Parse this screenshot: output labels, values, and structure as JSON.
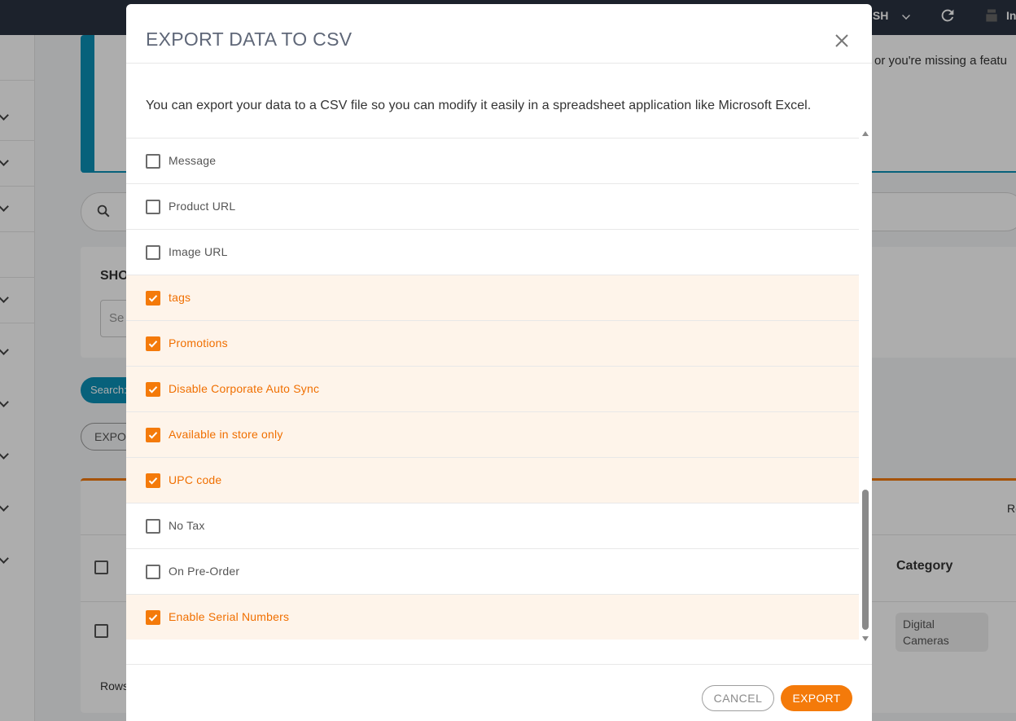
{
  "background": {
    "topbar": {
      "language_label": "ISH",
      "user_label": "In"
    },
    "banner_text": "or you're missing a featu",
    "filter": {
      "label": "SHO",
      "select_placeholder": "Se"
    },
    "search_chip": "Search:",
    "export_button": "EXPOR",
    "table": {
      "right_header": "Re",
      "category_header": "Category",
      "category_value": "Digital Cameras",
      "rows_label": "Rows"
    }
  },
  "modal": {
    "title": "EXPORT DATA TO CSV",
    "description": "You can export your data to a CSV file so you can modify it easily in a spreadsheet application like Microsoft Excel.",
    "fields": [
      {
        "label": "Message",
        "checked": false
      },
      {
        "label": "Product URL",
        "checked": false
      },
      {
        "label": "Image URL",
        "checked": false
      },
      {
        "label": "tags",
        "checked": true
      },
      {
        "label": "Promotions",
        "checked": true
      },
      {
        "label": "Disable Corporate Auto Sync",
        "checked": true
      },
      {
        "label": "Available in store only",
        "checked": true
      },
      {
        "label": "UPC code",
        "checked": true
      },
      {
        "label": "No Tax",
        "checked": false
      },
      {
        "label": "On Pre-Order",
        "checked": false
      },
      {
        "label": "Enable Serial Numbers",
        "checked": true
      }
    ],
    "cancel_label": "CANCEL",
    "export_label": "EXPORT"
  },
  "colors": {
    "accent": "#f47a0a",
    "checked_row": "#fef4ea",
    "topbar": "#2a3342",
    "info": "#0b8fb6"
  }
}
